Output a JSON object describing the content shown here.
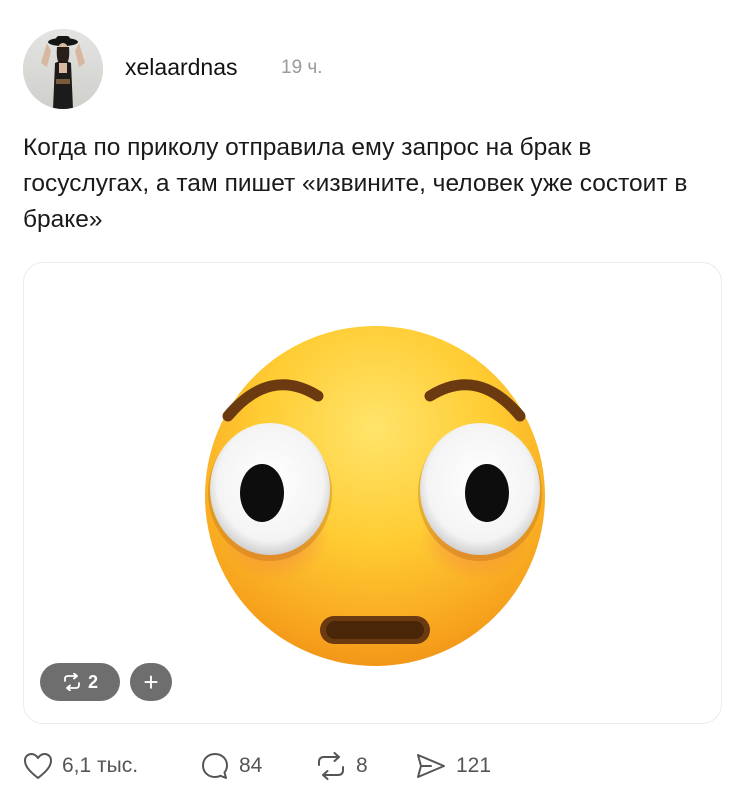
{
  "post": {
    "author": "xelaardnas",
    "time": "19 ч.",
    "text": "Когда по приколу отправила ему запрос на брак в госуслугах, а там пишет «извините, человек уже состоит в браке»",
    "media": {
      "emoji": "flushed-face",
      "repost_count": "2",
      "add_label": "+"
    },
    "actions": {
      "likes": "6,1 тыс.",
      "comments": "84",
      "reposts": "8",
      "shares": "121"
    }
  },
  "colors": {
    "chip_bg": "#6e6e6e",
    "muted": "#9a9a9a",
    "text": "#1a1a1a",
    "emoji_yellow": "#ffcf3a",
    "emoji_orange": "#f59a1e"
  }
}
